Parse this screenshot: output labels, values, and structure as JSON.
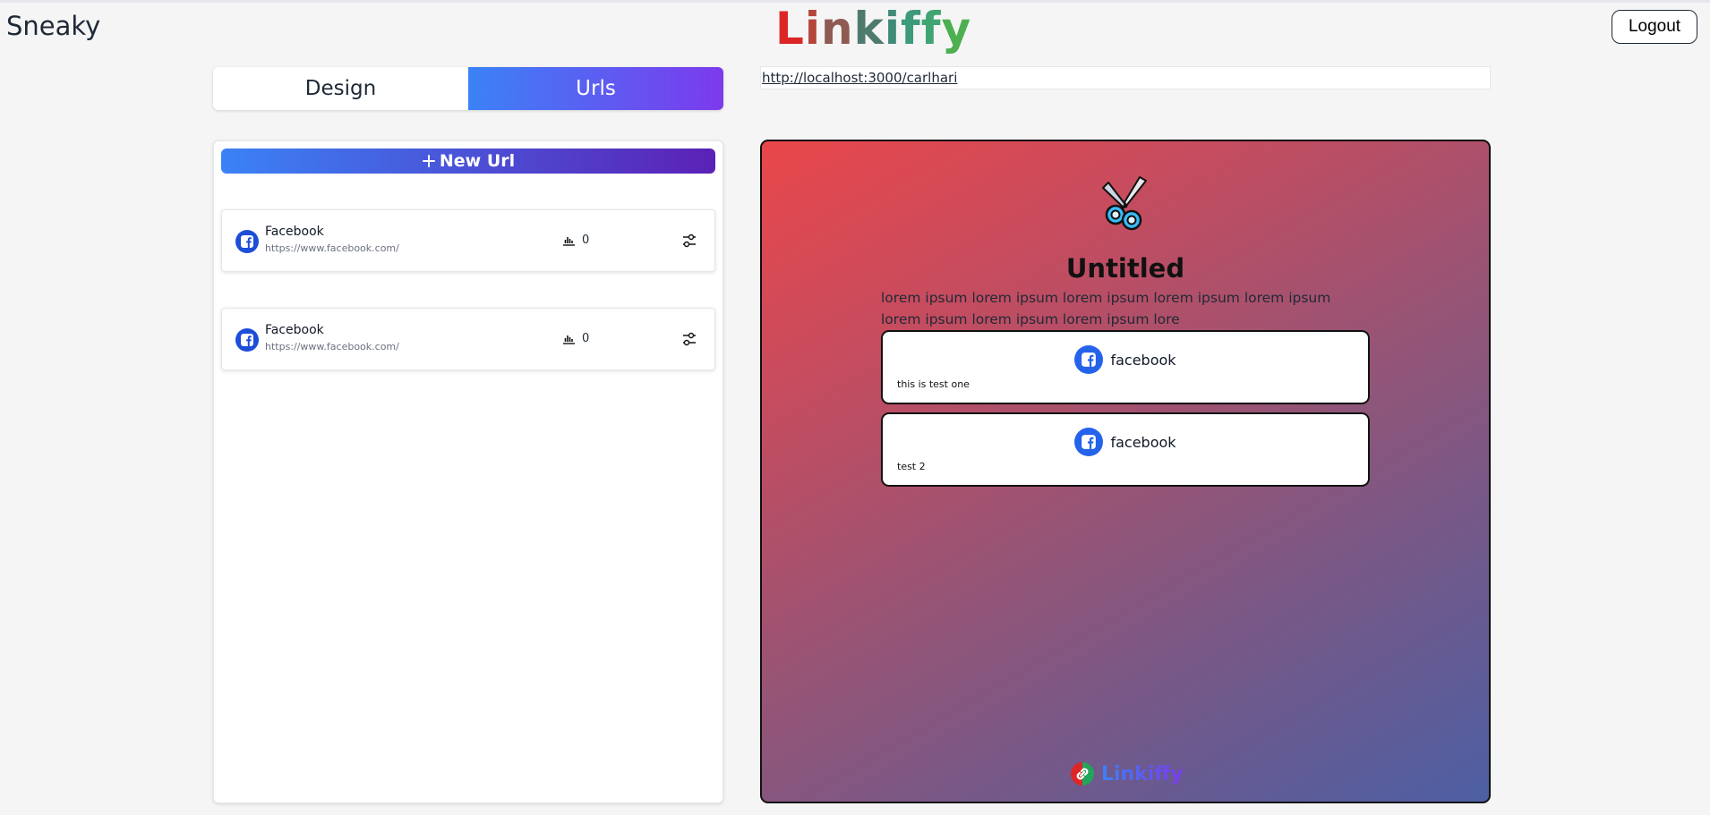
{
  "header": {
    "username": "Sneaky",
    "logo_letters": [
      {
        "char": "L",
        "color": "#dc2626"
      },
      {
        "char": "i",
        "color": "#b4453a"
      },
      {
        "char": "n",
        "color": "#8f5a52"
      },
      {
        "char": "k",
        "color": "#4f7b6e"
      },
      {
        "char": "i",
        "color": "#3f8a78"
      },
      {
        "char": "f",
        "color": "#3d9a7a"
      },
      {
        "char": "f",
        "color": "#3fa572"
      },
      {
        "char": "y",
        "color": "#4caf50"
      }
    ],
    "logout_label": "Logout"
  },
  "tabs": [
    {
      "label": "Design",
      "active": false
    },
    {
      "label": "Urls",
      "active": true
    }
  ],
  "url_bar": {
    "url": "http://localhost:3000/carlhari"
  },
  "left_panel": {
    "new_url_label": "New Url",
    "urls": [
      {
        "name": "Facebook",
        "link": "https://www.facebook.com/",
        "clicks": "0",
        "icon": "facebook-icon"
      },
      {
        "name": "Facebook",
        "link": "https://www.facebook.com/",
        "clicks": "0",
        "icon": "facebook-icon"
      }
    ]
  },
  "preview": {
    "gradient": [
      "#e9474a",
      "#4d5fa4"
    ],
    "title": "Untitled",
    "description": "lorem ipsum lorem ipsum lorem ipsum lorem ipsum lorem ipsum lorem ipsum lorem ipsum lorem ipsum lore",
    "links": [
      {
        "label": "facebook",
        "subtitle": "this is test one",
        "icon": "facebook-icon"
      },
      {
        "label": "facebook",
        "subtitle": "test 2",
        "icon": "facebook-icon"
      }
    ],
    "footer_brand": "Linkiffy"
  }
}
